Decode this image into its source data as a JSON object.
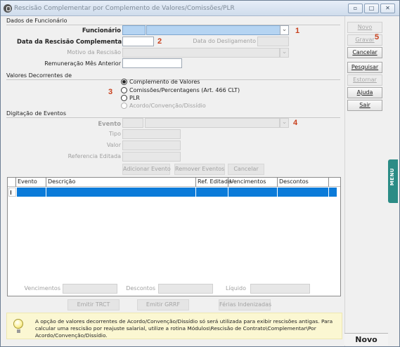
{
  "window": {
    "title": "Rescisão Complementar por Complemento de Valores/Comissões/PLR",
    "min_icon": "minimize-icon",
    "max_icon": "maximize-icon",
    "close_icon": "close-icon"
  },
  "dados_funcionario": {
    "section_title": "Dados de Funcionário",
    "funcionario_label": "Funcionário",
    "funcionario_code": "",
    "funcionario_name": "",
    "data_rescisao_label": "Data da Rescisão Complementar",
    "data_rescisao_value": "",
    "data_desligamento_label": "Data do Desligamento",
    "data_desligamento_value": "",
    "motivo_label": "Motivo da Rescisão",
    "motivo_value": "",
    "remuneracao_label": "Remuneração Mês Anterior",
    "remuneracao_value": ""
  },
  "valores": {
    "section_title": "Valores Decorrentes de",
    "options": [
      {
        "label": "Complemento de Valores",
        "checked": true,
        "enabled": true
      },
      {
        "label": "Comissões/Percentagens (Art. 466 CLT)",
        "checked": false,
        "enabled": true
      },
      {
        "label": "PLR",
        "checked": false,
        "enabled": true
      },
      {
        "label": "Acordo/Convenção/Dissídio",
        "checked": false,
        "enabled": false
      }
    ]
  },
  "eventos": {
    "section_title": "Digitação de Eventos",
    "evento_label": "Evento",
    "tipo_label": "Tipo",
    "valor_label": "Valor",
    "referencia_label": "Referencia Editada",
    "add_button": "Adicionar Evento",
    "remove_button": "Remover Eventos",
    "cancel_button": "Cancelar"
  },
  "grid": {
    "columns": [
      "Evento",
      "Descrição",
      "Ref. Editada",
      "Vencimentos",
      "Descontos"
    ],
    "rows": [
      {
        "evento": "",
        "descricao": "",
        "ref": "",
        "vencimentos": "",
        "descontos": ""
      }
    ]
  },
  "totals": {
    "vencimentos_label": "Vencimentos",
    "descontos_label": "Descontos",
    "liquido_label": "Líquido"
  },
  "actions": {
    "emitir_trct": "Emitir TRCT",
    "emitir_grrf": "Emitir GRRF",
    "ferias": "Férias Indenizadas"
  },
  "tip": {
    "icon": "lightbulb-icon",
    "text": "A opção de valores decorrentes de Acordo/Convenção/Dissídio só será utilizada para exibir rescisões antigas. Para calcular uma rescisão por reajuste salarial, utilize a rotina Módulos\\Rescisão de Contrato\\Complementar\\Por Acordo/Convenção/Dissídio."
  },
  "sidebar": {
    "novo": "Novo",
    "gravar": "Gravar",
    "cancelar": "Cancelar",
    "pesquisar": "Pesquisar",
    "estornar": "Estornar",
    "ajuda": "Ajuda",
    "sair": "Sair"
  },
  "menu_tab": "MENU",
  "status": "Novo",
  "callouts": [
    "1",
    "2",
    "3",
    "4",
    "5"
  ]
}
